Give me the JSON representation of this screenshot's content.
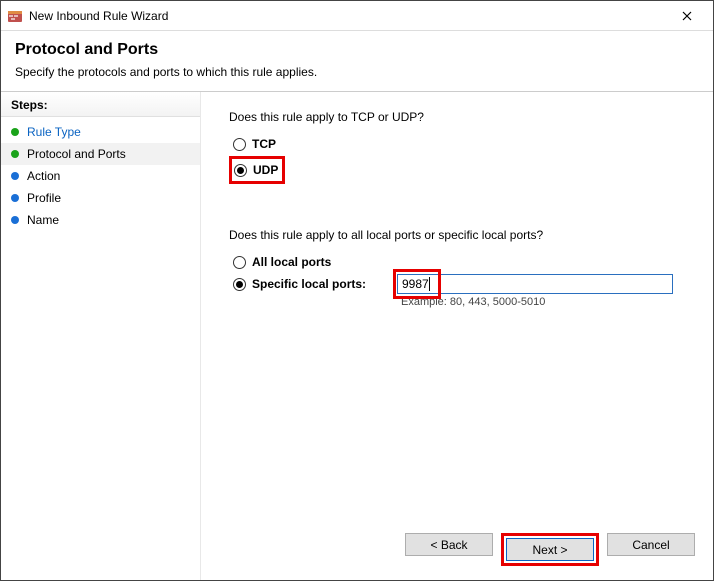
{
  "window": {
    "title": "New Inbound Rule Wizard"
  },
  "header": {
    "title": "Protocol and Ports",
    "subtitle": "Specify the protocols and ports to which this rule applies."
  },
  "sidebar": {
    "header": "Steps:",
    "items": [
      {
        "label": "Rule Type",
        "link": true,
        "current": false,
        "done": true
      },
      {
        "label": "Protocol and Ports",
        "link": false,
        "current": true,
        "done": true
      },
      {
        "label": "Action",
        "link": false,
        "current": false,
        "done": false
      },
      {
        "label": "Profile",
        "link": false,
        "current": false,
        "done": false
      },
      {
        "label": "Name",
        "link": false,
        "current": false,
        "done": false
      }
    ]
  },
  "main": {
    "q1": "Does this rule apply to TCP or UDP?",
    "tcp": "TCP",
    "udp": "UDP",
    "q2": "Does this rule apply to all local ports or specific local ports?",
    "all_ports": "All local ports",
    "specific_ports": "Specific local ports:",
    "ports_value": "9987",
    "ports_example": "Example: 80, 443, 5000-5010"
  },
  "footer": {
    "back": "< Back",
    "next": "Next >",
    "cancel": "Cancel"
  }
}
